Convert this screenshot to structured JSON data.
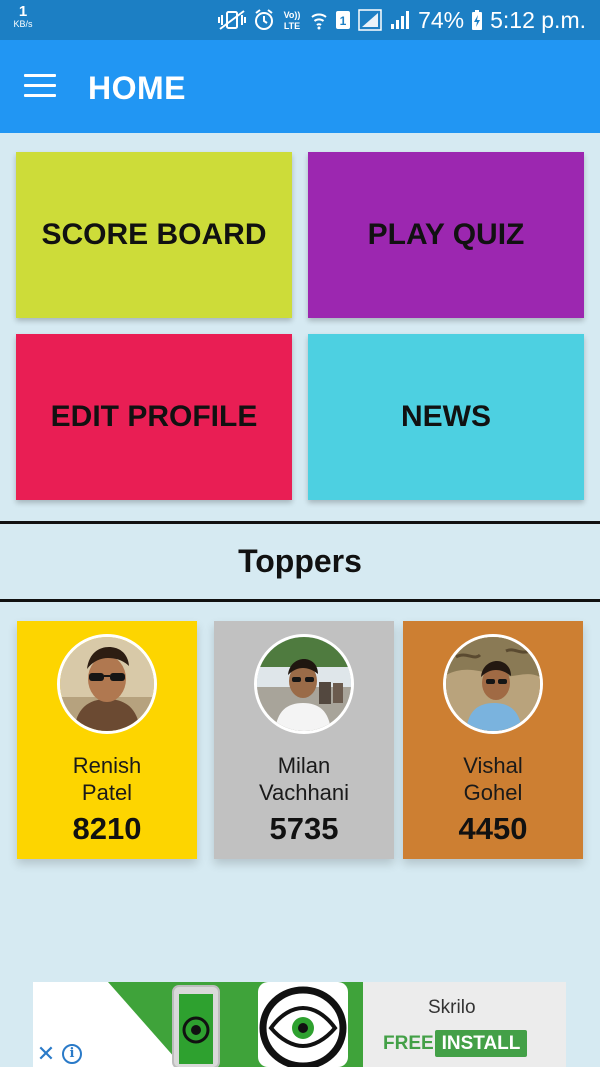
{
  "status_bar": {
    "net_speed": "1",
    "net_unit": "KB/s",
    "volte": "Vo)) LTE",
    "sim_badge": "1",
    "battery": "74%",
    "time": "5:12 p.m.",
    "icons": [
      "mute-vibrate-icon",
      "alarm-icon",
      "volte-icon",
      "wifi-icon",
      "sim-icon",
      "signal-icon",
      "signal-icon",
      "battery-charging-icon"
    ]
  },
  "app_bar": {
    "title": "HOME",
    "menu_icon": "menu-icon",
    "color": "#2196f3"
  },
  "tiles": [
    {
      "label": "SCORE BOARD",
      "color": "#cddc39"
    },
    {
      "label": "PLAY QUIZ",
      "color": "#9c27b0"
    },
    {
      "label": "EDIT PROFILE",
      "color": "#e91e54"
    },
    {
      "label": "NEWS",
      "color": "#4dd0e1"
    }
  ],
  "toppers": {
    "title": "Toppers",
    "cards": [
      {
        "first_name": "Renish",
        "last_name": "Patel",
        "score": "8210",
        "color": "#fdd500"
      },
      {
        "first_name": "Milan",
        "last_name": "Vachhani",
        "score": "5735",
        "color": "#c1c1c1"
      },
      {
        "first_name": "Vishal",
        "last_name": "Gohel",
        "score": "4450",
        "color": "#cd7f32"
      }
    ]
  },
  "ad": {
    "title": "Skrilo",
    "free_label": "FREE",
    "install_label": "INSTALL",
    "close_icon": "close-icon",
    "info_icon": "info-icon"
  }
}
